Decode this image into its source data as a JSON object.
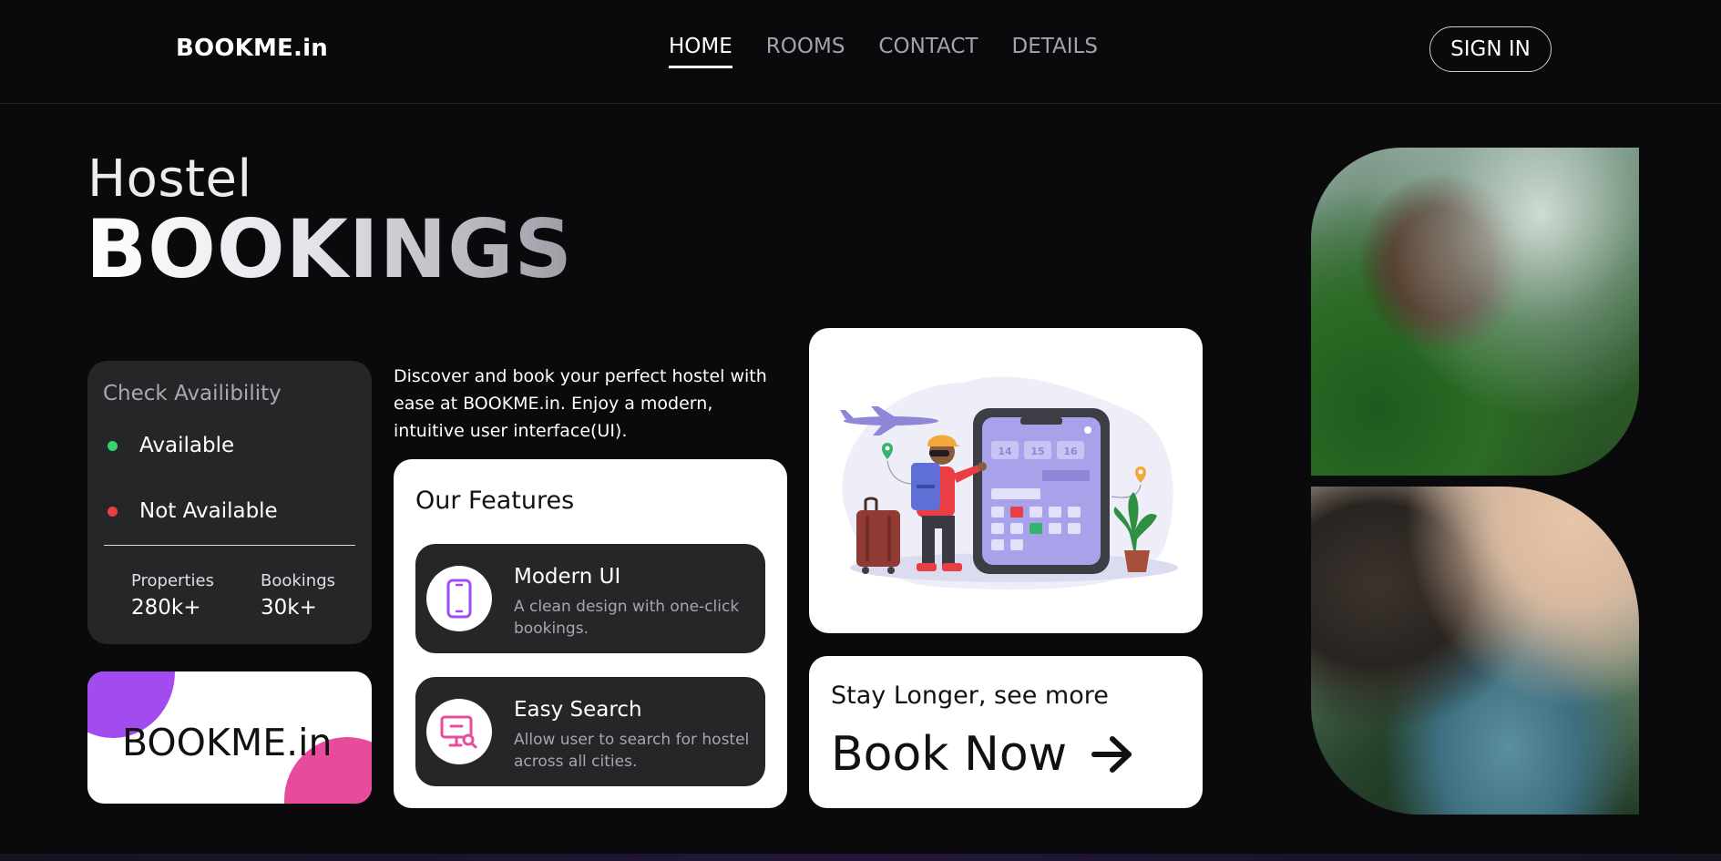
{
  "header": {
    "logo": "BOOKME.in",
    "nav": [
      {
        "label": "HOME",
        "active": true
      },
      {
        "label": "ROOMS",
        "active": false
      },
      {
        "label": "CONTACT",
        "active": false
      },
      {
        "label": "DETAILS",
        "active": false
      }
    ],
    "signin_label": "SIGN IN"
  },
  "hero": {
    "line1": "Hostel",
    "line2": "BOOKINGS"
  },
  "availability": {
    "title": "Check Availibility",
    "available_label": "Available",
    "not_available_label": "Not Available",
    "stats": [
      {
        "label": "Properties",
        "value": "280k+"
      },
      {
        "label": "Bookings",
        "value": "30k+"
      }
    ]
  },
  "brand_card": {
    "text": "BOOKME.in"
  },
  "description": "Discover and book your perfect hostel with ease at BOOKME.in. Enjoy a modern, intuitive user interface(UI).",
  "features": {
    "title": "Our Features",
    "items": [
      {
        "name": "Modern UI",
        "desc": "A clean design with one-click bookings.",
        "icon": "smartphone-icon"
      },
      {
        "name": "Easy Search",
        "desc": "Allow user to search for hostel across all cities.",
        "icon": "monitor-search-icon"
      }
    ]
  },
  "illustration": {
    "calendar_dates": [
      "14",
      "15",
      "16"
    ]
  },
  "cta": {
    "subtitle": "Stay Longer, see more",
    "button_label": "Book Now"
  },
  "colors": {
    "background": "#0a0a0c",
    "card_dark": "#262629",
    "available": "#34d36b",
    "not_available": "#ea3e45",
    "accent_purple": "#a24cf0",
    "accent_pink": "#e84a9c"
  }
}
